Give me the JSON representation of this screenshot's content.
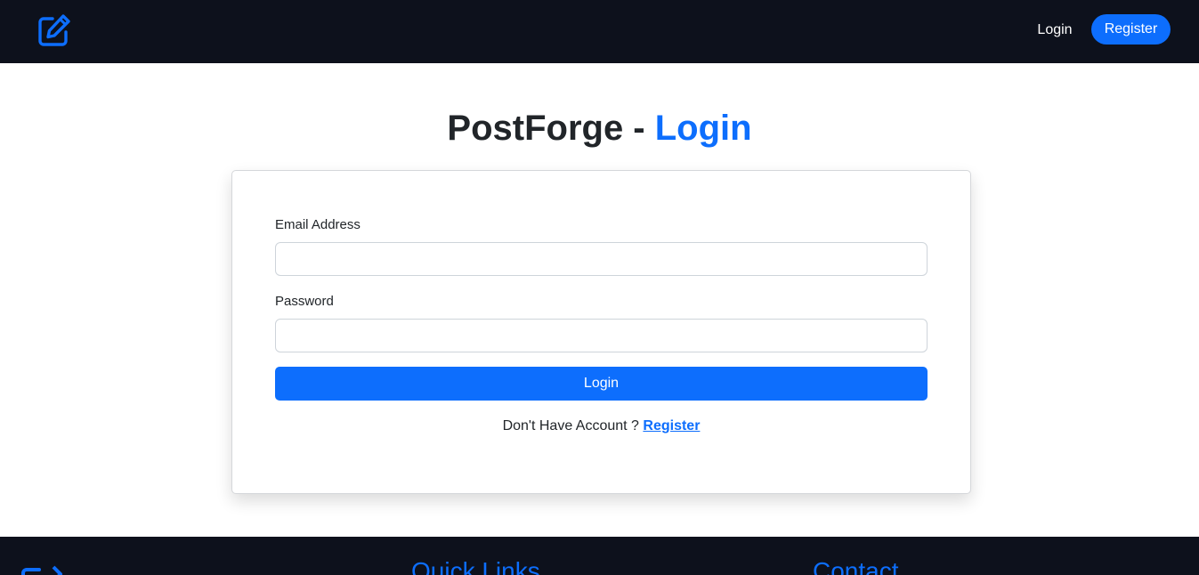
{
  "navbar": {
    "logo_icon": "edit-square-icon",
    "login_label": "Login",
    "register_label": "Register"
  },
  "header": {
    "title_prefix": "PostForge - ",
    "title_accent": "Login"
  },
  "form": {
    "email_label": "Email Address",
    "email_value": "",
    "password_label": "Password",
    "password_value": "",
    "submit_label": "Login",
    "prompt_text": "Don't Have Account ? ",
    "register_link": "Register"
  },
  "footer": {
    "logo_icon": "edit-square-icon",
    "quick_links_heading": "Quick Links",
    "contact_heading": "Contact"
  },
  "colors": {
    "accent": "#0d6efd",
    "navbar_bg": "#0d111c",
    "text": "#212529"
  }
}
